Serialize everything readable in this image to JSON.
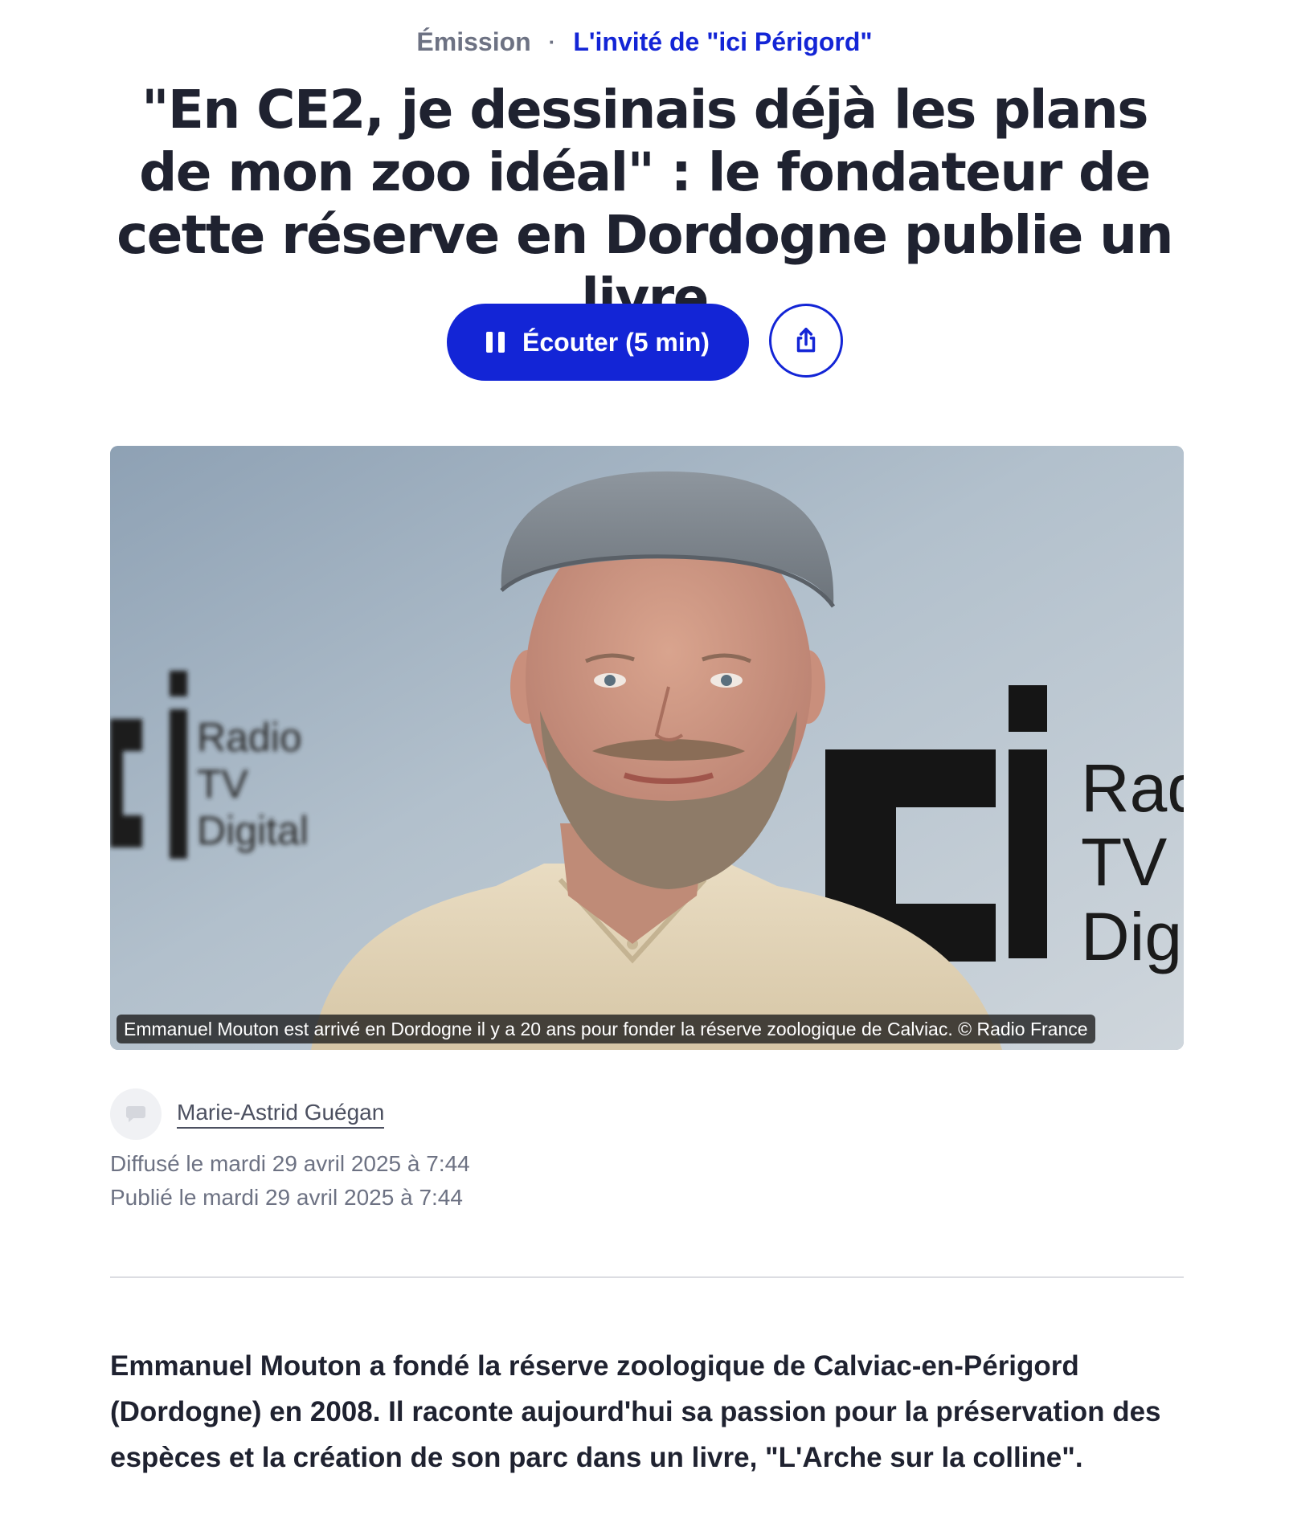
{
  "breadcrumb": {
    "category": "Émission",
    "separator": "·",
    "show": "L'invité de \"ici Périgord\""
  },
  "article": {
    "title": "\"En CE2, je dessinais déjà les plans de mon zoo idéal\" : le fondateur de cette réserve en Dordogne publie un livre",
    "lead": "Emmanuel Mouton a fondé la réserve zoologique de Calviac-en-Périgord (Dordogne) en 2008. Il raconte aujourd'hui sa passion pour la préservation des espèces et la création de son parc dans un livre, \"L'Arche sur la colline\"."
  },
  "actions": {
    "listen_label": "Écouter (5 min)",
    "listen_icon": "pause-icon",
    "share_icon": "share-icon"
  },
  "photo": {
    "caption": "Emmanuel Mouton est arrivé en Dordogne il y a 20 ans pour fonder la réserve zoologique de Calviac. © Radio France",
    "backdrop_logo": {
      "mark": "ici",
      "lines_left": [
        "Radio",
        "TV",
        "Digital"
      ],
      "lines_right": [
        "Rad",
        "TV",
        "Dig"
      ]
    }
  },
  "author": {
    "name": "Marie-Astrid Guégan",
    "avatar_icon": "speech-bubble-icon"
  },
  "dates": {
    "broadcast": "Diffusé le mardi 29 avril 2025 à 7:44",
    "published": "Publié le mardi 29 avril 2025 à 7:44"
  },
  "colors": {
    "accent": "#1325d6",
    "text": "#1f2230",
    "muted": "#6d7283",
    "divider": "#dcdde2"
  }
}
